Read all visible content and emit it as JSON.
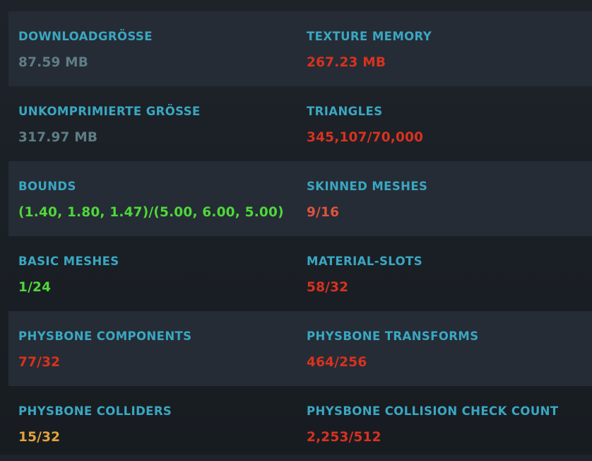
{
  "rows": [
    {
      "left": {
        "label": "DOWNLOADGRÖßE",
        "value": "87.59 MB",
        "status_color": "#5f7d86"
      },
      "right": {
        "label": "TEXTURE MEMORY",
        "value": "267.23 MB",
        "status_color": "#d9321f"
      }
    },
    {
      "left": {
        "label": "UNKOMPRIMIERTE GRÖßE",
        "value": "317.97 MB",
        "status_color": "#5f7d86"
      },
      "right": {
        "label": "TRIANGLES",
        "value": "345,107/70,000",
        "status_color": "#d9321f"
      }
    },
    {
      "left": {
        "label": "BOUNDS",
        "value": "(1.40, 1.80, 1.47)/(5.00, 6.00, 5.00)",
        "status_color": "#4fd83a"
      },
      "right": {
        "label": "SKINNED MESHES",
        "value": "9/16",
        "status_color": "#e0533f"
      }
    },
    {
      "left": {
        "label": "BASIC MESHES",
        "value": "1/24",
        "status_color": "#4fd83a"
      },
      "right": {
        "label": "MATERIAL-SLOTS",
        "value": "58/32",
        "status_color": "#d9321f"
      }
    },
    {
      "left": {
        "label": "PHYSBONE COMPONENTS",
        "value": "77/32",
        "status_color": "#d9321f"
      },
      "right": {
        "label": "PHYSBONE TRANSFORMS",
        "value": "464/256",
        "status_color": "#d9321f"
      }
    },
    {
      "left": {
        "label": "PHYSBONE COLLIDERS",
        "value": "15/32",
        "status_color": "#e3a33a"
      },
      "right": {
        "label": "PHYSBONE COLLISION CHECK COUNT",
        "value": "2,253/512",
        "status_color": "#d9321f"
      }
    }
  ],
  "theme": {
    "label_color": "#3aa7c2",
    "shaded_row_color": "#252c35",
    "background_color": "#1b2026"
  }
}
